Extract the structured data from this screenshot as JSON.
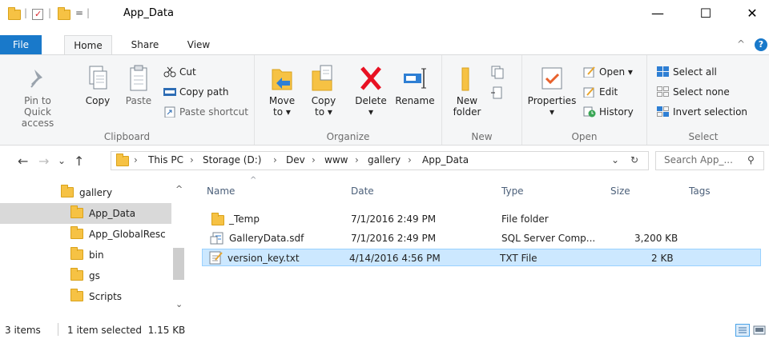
{
  "window": {
    "title": "App_Data",
    "minimize_label": "—",
    "maximize_label": "☐",
    "close_label": "✕"
  },
  "quick_access": {
    "separator": "|",
    "dropdown": "="
  },
  "tabs": [
    {
      "label": "File"
    },
    {
      "label": "Home"
    },
    {
      "label": "Share"
    },
    {
      "label": "View"
    }
  ],
  "ribbon": {
    "collapse_label": "^",
    "help_label": "?",
    "clipboard": {
      "label": "Clipboard",
      "pin_label": "Pin to Quick",
      "pin_label2": "access",
      "copy_label": "Copy",
      "paste_label": "Paste",
      "cut_label": "Cut",
      "copy_path_label": "Copy path",
      "paste_shortcut_label": "Paste shortcut"
    },
    "organize": {
      "label": "Organize",
      "move_label": "Move",
      "move_label2": "to ▾",
      "copy_label": "Copy",
      "copy_label2": "to ▾",
      "delete_label": "Delete",
      "delete_label2": "▾",
      "rename_label": "Rename"
    },
    "new": {
      "label": "New",
      "new_folder_label": "New",
      "new_folder_label2": "folder"
    },
    "open": {
      "label": "Open",
      "properties_label": "Properties",
      "properties_label2": "▾",
      "open_label": "Open ▾",
      "edit_label": "Edit",
      "history_label": "History"
    },
    "select": {
      "label": "Select",
      "select_all_label": "Select all",
      "select_none_label": "Select none",
      "invert_label": "Invert selection"
    }
  },
  "address": {
    "back": "←",
    "forward": "→",
    "recent": "⌄",
    "up": "↑",
    "crumbs": [
      "This PC",
      "Storage (D:)",
      "Dev",
      "www",
      "gallery",
      "App_Data"
    ],
    "separator": "›",
    "dropdown": "⌄",
    "refresh": "↻",
    "search_placeholder": "Search App_...",
    "search_icon": "⚲"
  },
  "nav_pane": {
    "items": [
      {
        "label": "gallery"
      },
      {
        "label": "App_Data"
      },
      {
        "label": "App_GlobalResc"
      },
      {
        "label": "bin"
      },
      {
        "label": "gs"
      },
      {
        "label": "Scripts"
      }
    ],
    "scroll_up": "^",
    "scroll_down": "⌄"
  },
  "file_list": {
    "sort_indicator": "^",
    "columns": [
      "Name",
      "Date",
      "Type",
      "Size",
      "Tags"
    ],
    "rows": [
      {
        "name": "_Temp",
        "date": "7/1/2016 2:49 PM",
        "type": "File folder",
        "size": ""
      },
      {
        "name": "GalleryData.sdf",
        "date": "7/1/2016 2:49 PM",
        "type": "SQL Server Comp...",
        "size": "3,200 KB"
      },
      {
        "name": "version_key.txt",
        "date": "4/14/2016 4:56 PM",
        "type": "TXT File",
        "size": "2 KB"
      }
    ]
  },
  "status": {
    "items_count": "3 items",
    "selected": "1 item selected  1.15 KB"
  },
  "colors": {
    "accent": "#1979ca",
    "selection": "#cce8ff",
    "folder": "#f6c244"
  }
}
